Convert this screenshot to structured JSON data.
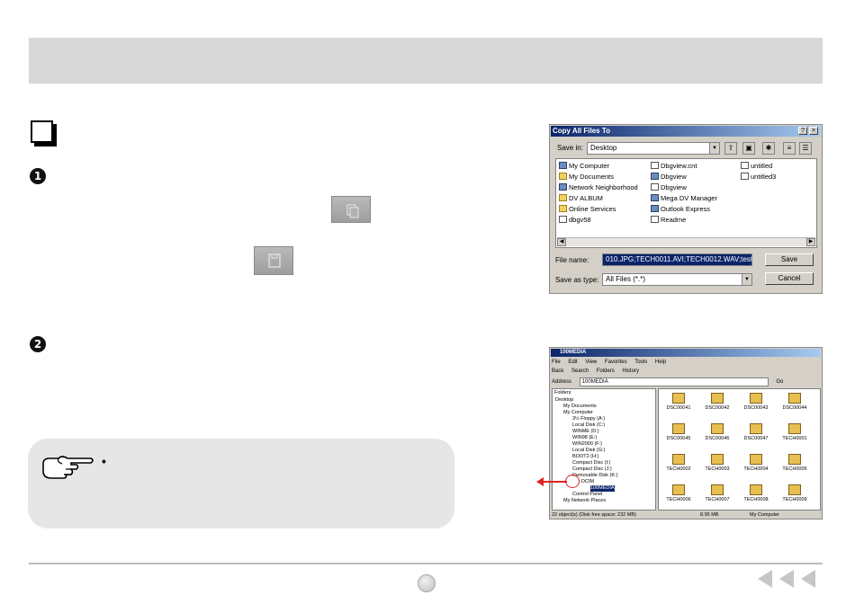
{
  "step_numbers": {
    "first": "1",
    "second": "2"
  },
  "tip_bullet": "•",
  "dialog": {
    "title": "Copy All Files To",
    "help_btn": "?",
    "close_btn": "×",
    "save_in_label": "Save in:",
    "save_in_value": "Desktop",
    "files_col1": [
      "My Computer",
      "My Documents",
      "Network Neighborhood",
      "DV ALBUM",
      "Online Services",
      "dbgv58"
    ],
    "files_col2": [
      "Dbgview.cnt",
      "Dbgview",
      "Dbgview",
      "Mega DV Manager",
      "Outlook Express",
      "Readme"
    ],
    "files_col3": [
      "untitled",
      "untitled3"
    ],
    "file_name_label": "File name:",
    "file_name_value": "010.JPG;TECH0011.AVI;TECH0012.WAV;test!",
    "save_type_label": "Save as type:",
    "save_type_value": "All Files (*.*)",
    "save_button": "Save",
    "cancel_button": "Cancel"
  },
  "explorer": {
    "title": "100MEDIA",
    "menu": [
      "File",
      "Edit",
      "View",
      "Favorites",
      "Tools",
      "Help"
    ],
    "toolbar": [
      "Back",
      "Search",
      "Folders",
      "History"
    ],
    "address_label": "Address",
    "address_value": "100MEDIA",
    "go_label": "Go",
    "folders_header": "Folders",
    "tree": [
      "Desktop",
      "My Documents",
      "My Computer",
      "3½ Floppy (A:)",
      "Local Disk (C:)",
      "WINME (D:)",
      "WIN98 (E:)",
      "WIN2000 (F:)",
      "Local Disk (G:)",
      "BOOT2 (H:)",
      "Compact Disc (I:)",
      "Compact Disc (J:)",
      "Removable Disk (K:)",
      "DCIM",
      "100MEDIA",
      "Control Panel",
      "My Network Places"
    ],
    "files": [
      "DSC00041",
      "DSC00042",
      "DSC00043",
      "DSC00044",
      "DSC00045",
      "DSC00046",
      "DSC00047",
      "TECH0001",
      "TECH0002",
      "TECH0003",
      "TECH0004",
      "TECH0005",
      "TECH0006",
      "TECH0007",
      "TECH0008",
      "TECH0009"
    ],
    "status_left": "22 object(s) (Disk free space: 232 MB)",
    "status_size": "8.95 MB",
    "status_location": "My Computer"
  }
}
